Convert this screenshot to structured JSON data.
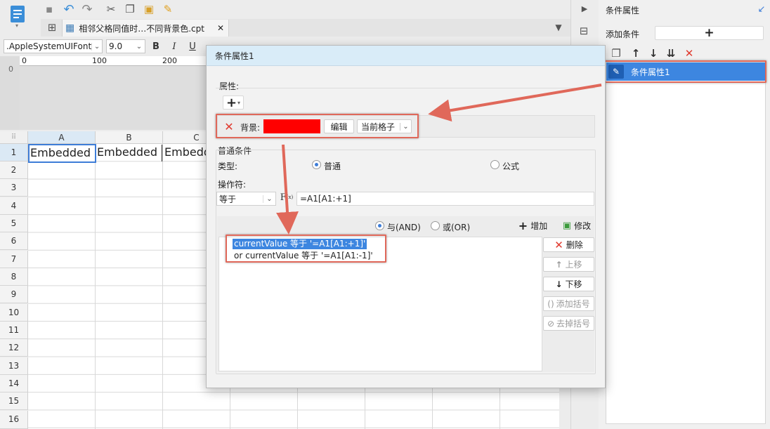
{
  "toolbar": {
    "file_tab": "相邻父格同值时…不同背景色.cpt",
    "font_name": ".AppleSystemUIFont",
    "font_size": "9.0",
    "bold": "B",
    "italic": "I",
    "underline": "U"
  },
  "ruler": {
    "marks": [
      "0",
      "100",
      "200"
    ]
  },
  "sheet": {
    "columns": [
      "A",
      "B",
      "C"
    ],
    "rows": [
      "1",
      "2",
      "3",
      "4",
      "5",
      "6",
      "7",
      "8",
      "9",
      "10",
      "11",
      "12",
      "13",
      "14",
      "15",
      "16"
    ],
    "row1_cells": [
      "Embedded",
      "Embedded",
      "Embedde"
    ]
  },
  "right_panel": {
    "title": "条件属性",
    "add_condition_label": "添加条件",
    "add_button": "+",
    "list_item": "条件属性1"
  },
  "dialog": {
    "title": "条件属性1",
    "attributes_label": "属性:",
    "add_attr": "+",
    "background_label": "背景:",
    "background_color": "#ff0000",
    "edit_button": "编辑",
    "scope_value": "当前格子",
    "general_condition_label": "普通条件",
    "type_label": "类型:",
    "type_normal": "普通",
    "type_formula": "公式",
    "operator_label": "操作符:",
    "operator_value": "等于",
    "formula_value": "=A1[A1:+1]",
    "and_label": "与(AND)",
    "or_label": "或(OR)",
    "add_button": "增加",
    "modify_button": "修改",
    "conditions": [
      "currentValue 等于 '=A1[A1:+1]'",
      "or  currentValue 等于 '=A1[A1:-1]'"
    ],
    "delete_button": "删除",
    "move_up_button": "上移",
    "move_down_button": "下移",
    "add_bracket_button": "添加括号",
    "remove_bracket_button": "去掉括号"
  },
  "colors": {
    "accent": "#3d7dd8",
    "highlight": "#d8ebf9",
    "annotation": "#e0685a"
  }
}
